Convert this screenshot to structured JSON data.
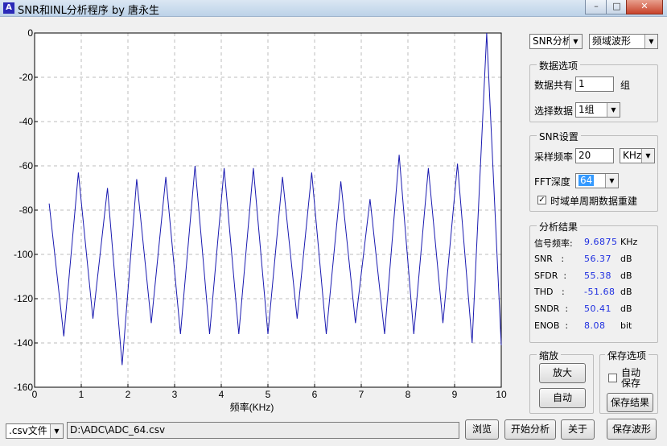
{
  "window": {
    "title": "SNR和INL分析程序 by 唐永生",
    "icon": "app-icon",
    "minimize": "–",
    "maximize": "□",
    "close": "✕"
  },
  "chart_data": {
    "type": "line",
    "xlabel": "频率(KHz)",
    "ylabel": "",
    "xlim": [
      0,
      10
    ],
    "ylim": [
      -160,
      0
    ],
    "xticks": [
      "0",
      "1",
      "2",
      "3",
      "4",
      "5",
      "6",
      "7",
      "8",
      "9",
      "10"
    ],
    "yticks": [
      "0",
      "-20",
      "-40",
      "-60",
      "-80",
      "-100",
      "-120",
      "-140",
      "-160"
    ],
    "grid": true,
    "line_color": "#1a1ab0",
    "x": [
      0.3125,
      0.625,
      0.9375,
      1.25,
      1.5625,
      1.875,
      2.1875,
      2.5,
      2.8125,
      3.125,
      3.4375,
      3.75,
      4.0625,
      4.375,
      4.6875,
      5.0,
      5.3125,
      5.625,
      5.9375,
      6.25,
      6.5625,
      6.875,
      7.1875,
      7.5,
      7.8125,
      8.125,
      8.4375,
      8.75,
      9.0625,
      9.375,
      9.6875,
      10.0
    ],
    "values": [
      -77,
      -137,
      -63,
      -129,
      -70,
      -150,
      -66,
      -131,
      -65,
      -136,
      -60,
      -136,
      -61,
      -136,
      -61,
      -136,
      -65,
      -129,
      -63,
      -136,
      -67,
      -131,
      -75,
      -136,
      -55,
      -136,
      -61,
      -131,
      -59,
      -140,
      0,
      -141
    ]
  },
  "controls": {
    "mode_select": "SNR分析",
    "view_select": "频域波形",
    "data_options": {
      "legend": "数据选项",
      "total_label": "数据共有",
      "total_value": "1",
      "total_unit": "组",
      "select_label": "选择数据",
      "select_value": "1组"
    },
    "snr_settings": {
      "legend": "SNR设置",
      "fs_label": "采样频率",
      "fs_value": "20",
      "fs_unit": "KHz",
      "fft_label": "FFT深度",
      "fft_value": "64",
      "rebuild_label": "时域单周期数据重建",
      "rebuild_checked": true
    },
    "results": {
      "legend": "分析结果",
      "rows": [
        {
          "label": "信号频率:",
          "value": "9.6875",
          "unit": "KHz"
        },
        {
          "label": "SNR   :",
          "value": "56.37",
          "unit": "dB"
        },
        {
          "label": "SFDR  :",
          "value": "55.38",
          "unit": "dB"
        },
        {
          "label": "THD   :",
          "value": "-51.68",
          "unit": "dB"
        },
        {
          "label": "SNDR  :",
          "value": "50.41",
          "unit": "dB"
        },
        {
          "label": "ENOB  :",
          "value": "8.08",
          "unit": "bit"
        }
      ]
    },
    "zoom": {
      "legend": "缩放",
      "zoom_in": "放大",
      "auto": "自动"
    },
    "save": {
      "legend": "保存选项",
      "auto_save_line1": "自动",
      "auto_save_line2": "保存",
      "auto_save_checked": false,
      "save_results": "保存结果",
      "save_waveform": "保存波形"
    }
  },
  "bottom": {
    "file_type": ".csv文件",
    "path": "D:\\ADC\\ADC_64.csv",
    "browse": "浏览",
    "start": "开始分析",
    "about": "关于"
  }
}
